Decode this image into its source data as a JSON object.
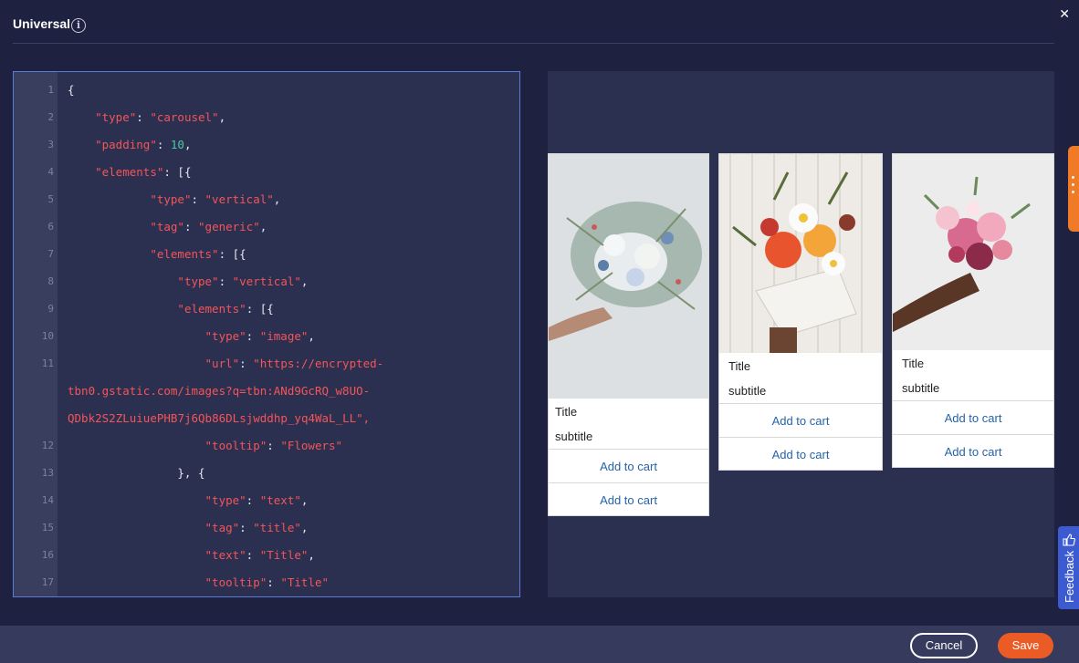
{
  "header": {
    "title": "Universal",
    "info_icon": "info-icon",
    "close_icon": "close-icon",
    "close_glyph": "✕"
  },
  "editor": {
    "lines": [
      {
        "num": "1",
        "text": "{"
      },
      {
        "num": "2",
        "text": "    \"type\": \"carousel\","
      },
      {
        "num": "3",
        "text": "    \"padding\": 10,"
      },
      {
        "num": "4",
        "text": "    \"elements\": [{"
      },
      {
        "num": "5",
        "text": "            \"type\": \"vertical\","
      },
      {
        "num": "6",
        "text": "            \"tag\": \"generic\","
      },
      {
        "num": "7",
        "text": "            \"elements\": [{"
      },
      {
        "num": "8",
        "text": "                \"type\": \"vertical\","
      },
      {
        "num": "9",
        "text": "                \"elements\": [{"
      },
      {
        "num": "10",
        "text": "                    \"type\": \"image\","
      },
      {
        "num": "11",
        "text": "                    \"url\": \"https://encrypted-"
      },
      {
        "num": "",
        "text": "tbn0.gstatic.com/images?q=tbn:ANd9GcRQ_w8UO-"
      },
      {
        "num": "",
        "text": "QDbk2S2ZLuiuePHB7j6Qb86DLsjwddhp_yq4WaL_LL\","
      },
      {
        "num": "12",
        "text": "                    \"tooltip\": \"Flowers\""
      },
      {
        "num": "13",
        "text": "                }, {"
      },
      {
        "num": "14",
        "text": "                    \"type\": \"text\","
      },
      {
        "num": "15",
        "text": "                    \"tag\": \"title\","
      },
      {
        "num": "16",
        "text": "                    \"text\": \"Title\","
      },
      {
        "num": "17",
        "text": "                    \"tooltip\": \"Title\""
      }
    ]
  },
  "preview": {
    "cards": [
      {
        "title": "Title",
        "subtitle": "subtitle",
        "buttons": [
          "Add to cart",
          "Add to cart"
        ]
      },
      {
        "title": "Title",
        "subtitle": "subtitle",
        "buttons": [
          "Add to cart",
          "Add to cart"
        ]
      },
      {
        "title": "Title",
        "subtitle": "subtitle",
        "buttons": [
          "Add to cart",
          "Add to cart"
        ]
      }
    ]
  },
  "feedback": {
    "label": "Feedback",
    "icon": "thumbs-up-icon"
  },
  "footer": {
    "cancel_label": "Cancel",
    "save_label": "Save"
  },
  "colors": {
    "background": "#1e2240",
    "panel": "#2c3050",
    "accent": "#ea5b25",
    "string": "#f2555a",
    "number": "#4cc9a4",
    "link": "#2563a8",
    "feedback": "#3d5bd1"
  }
}
